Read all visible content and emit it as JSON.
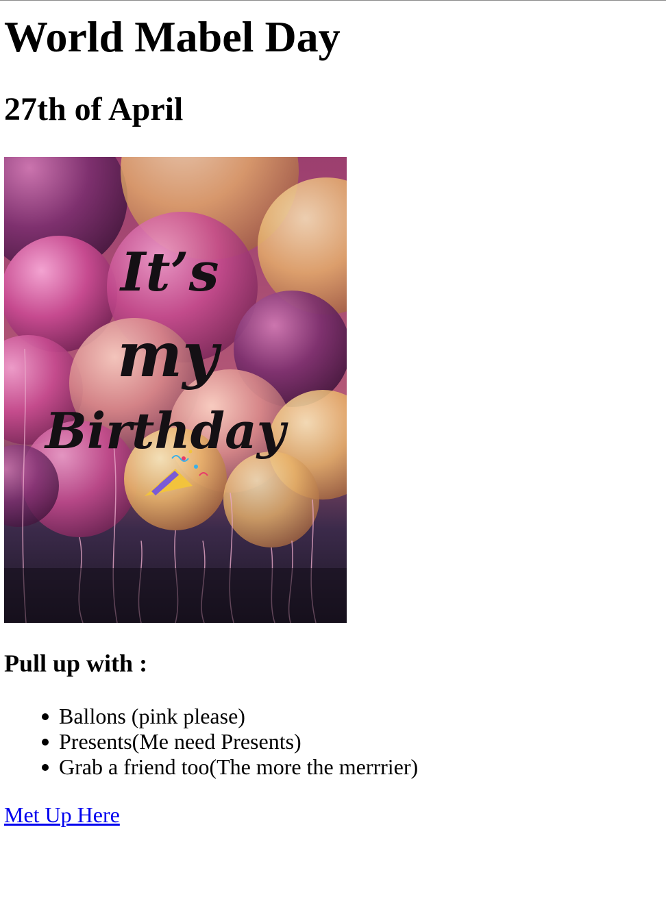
{
  "page": {
    "title": "World Mabel Day",
    "date": "27th of April",
    "image": {
      "lines": [
        "It’s",
        "my",
        "Birthday"
      ],
      "emoji": "party-popper-icon"
    },
    "section_heading": "Pull up with :",
    "list_items": [
      "Ballons (pink please)",
      "Presents(Me need Presents)",
      "Grab a friend too(The more the merrrier)"
    ],
    "link_text": "Met Up Here"
  },
  "colors": {
    "text": "#000000",
    "link": "#0000ee",
    "background": "#ffffff",
    "balloon_pink": "#c64a8f",
    "balloon_gold": "#e9b36a",
    "balloon_purple": "#7a2e6e"
  }
}
